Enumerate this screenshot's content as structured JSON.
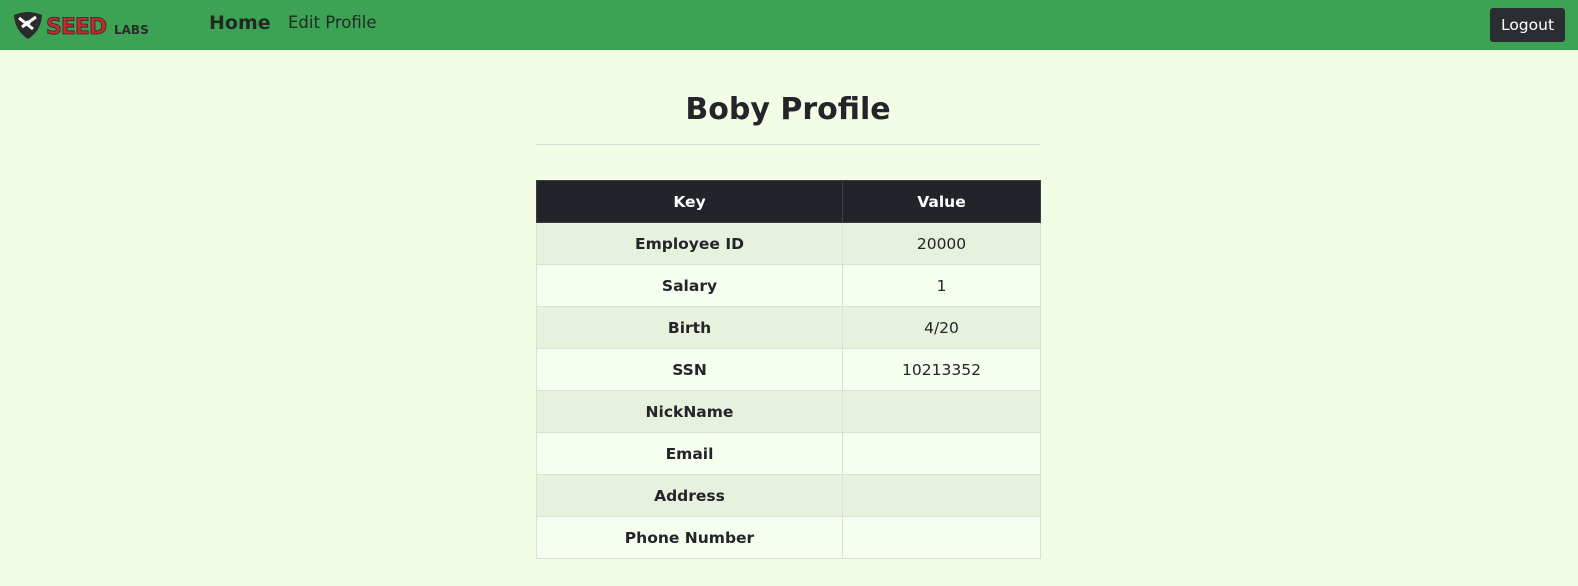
{
  "nav": {
    "logo_text": "SEEDLABS",
    "home_label": "Home",
    "edit_profile_label": "Edit Profile",
    "logout_label": "Logout",
    "bar_color": "#3da354"
  },
  "main": {
    "title": "Boby Profile",
    "table": {
      "headers": [
        "Key",
        "Value"
      ],
      "rows": [
        {
          "key": "Employee ID",
          "value": "20000"
        },
        {
          "key": "Salary",
          "value": "1"
        },
        {
          "key": "Birth",
          "value": "4/20"
        },
        {
          "key": "SSN",
          "value": "10213352"
        },
        {
          "key": "NickName",
          "value": ""
        },
        {
          "key": "Email",
          "value": ""
        },
        {
          "key": "Address",
          "value": ""
        },
        {
          "key": "Phone Number",
          "value": ""
        }
      ]
    }
  }
}
